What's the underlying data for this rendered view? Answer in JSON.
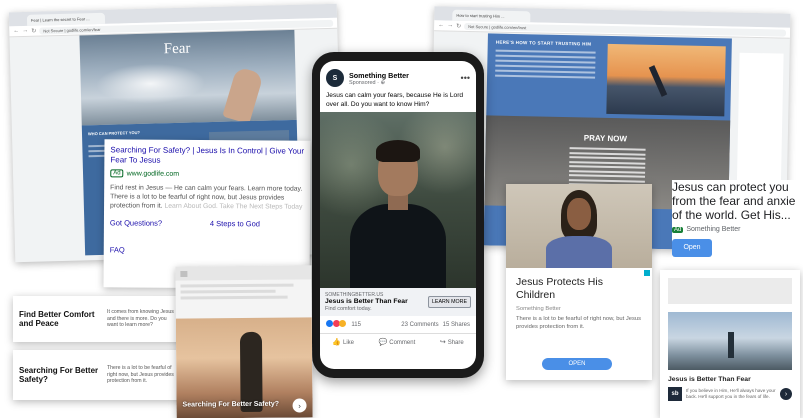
{
  "browser_left": {
    "tab_title": "Fear | Learn the secret to Fear ...",
    "url": "Not Secure | godlife.com/en/fear",
    "hero_title": "Fear",
    "section_label": "WHO CAN PROTECT YOU?"
  },
  "browser_right": {
    "tab_title": "How to start trusting Him ...",
    "url": "Not Secure | godlife.com/en/trust",
    "heading": "HERE'S HOW TO START TRUSTING HIM",
    "pray_now": "PRAY NOW"
  },
  "search_ad": {
    "title": "Searching For Safety? | Jesus Is In Control | Give Your Fear To Jesus",
    "badge": "Ad",
    "url": "www.godlife.com",
    "desc_main": "Find rest in Jesus — He can calm your fears. Learn more today. There is a lot to be fearful of right now, but Jesus provides protection from it.",
    "desc_faded": "Learn About God. Take The Next Steps Today",
    "links": [
      "Got Questions?",
      "4 Steps to God",
      "FAQ"
    ]
  },
  "facebook_ad": {
    "avatar_letter": "S",
    "page_name": "Something Better",
    "sponsored": "Sponsored · ⊕",
    "more": "•••",
    "post_text": "Jesus can calm your fears, because He is Lord over all. Do you want to know Him?",
    "domain": "SOMETHINGBETTER.US",
    "headline": "Jesus is Better Than Fear",
    "subtext": "Find comfort today.",
    "cta": "LEARN MORE",
    "reaction_count": "115",
    "comments": "23 Comments",
    "shares": "15 Shares",
    "actions": {
      "like": "Like",
      "comment": "Comment",
      "share": "Share"
    },
    "reaction_colors": [
      "#1877f2",
      "#f33e58",
      "#f7b125"
    ]
  },
  "text_ads": [
    {
      "title": "Find Better Comfort and Peace",
      "desc": "It comes from knowing Jesus and there is more. Do you want to learn more?",
      "arrow": "›"
    },
    {
      "title": "Searching For Better Safety?",
      "desc": "There is a lot to be fearful of right now, but Jesus provides protection from it.",
      "arrow": "›"
    }
  ],
  "mobile_web_ad": {
    "caption": "Searching For Better Safety?",
    "arrow": "›"
  },
  "display_ad": {
    "title": "Jesus Protects His Children",
    "brand": "Something Better",
    "desc": "There is a lot to be fearful of right now, but Jesus provides protection from it.",
    "button": "OPEN"
  },
  "right_text_ad": {
    "title_lines": [
      "Jesus can protect you",
      "from the fear and anxie",
      "of the world. Get His..."
    ],
    "badge": "Ad",
    "brand": "Something Better",
    "button": "Open"
  },
  "native_ad": {
    "title": "Jesus is Better Than Fear",
    "logo": "sb",
    "desc": "If you believe in Him, He'll always have your back. He'll support you in the fears of life.",
    "arrow": "›"
  }
}
